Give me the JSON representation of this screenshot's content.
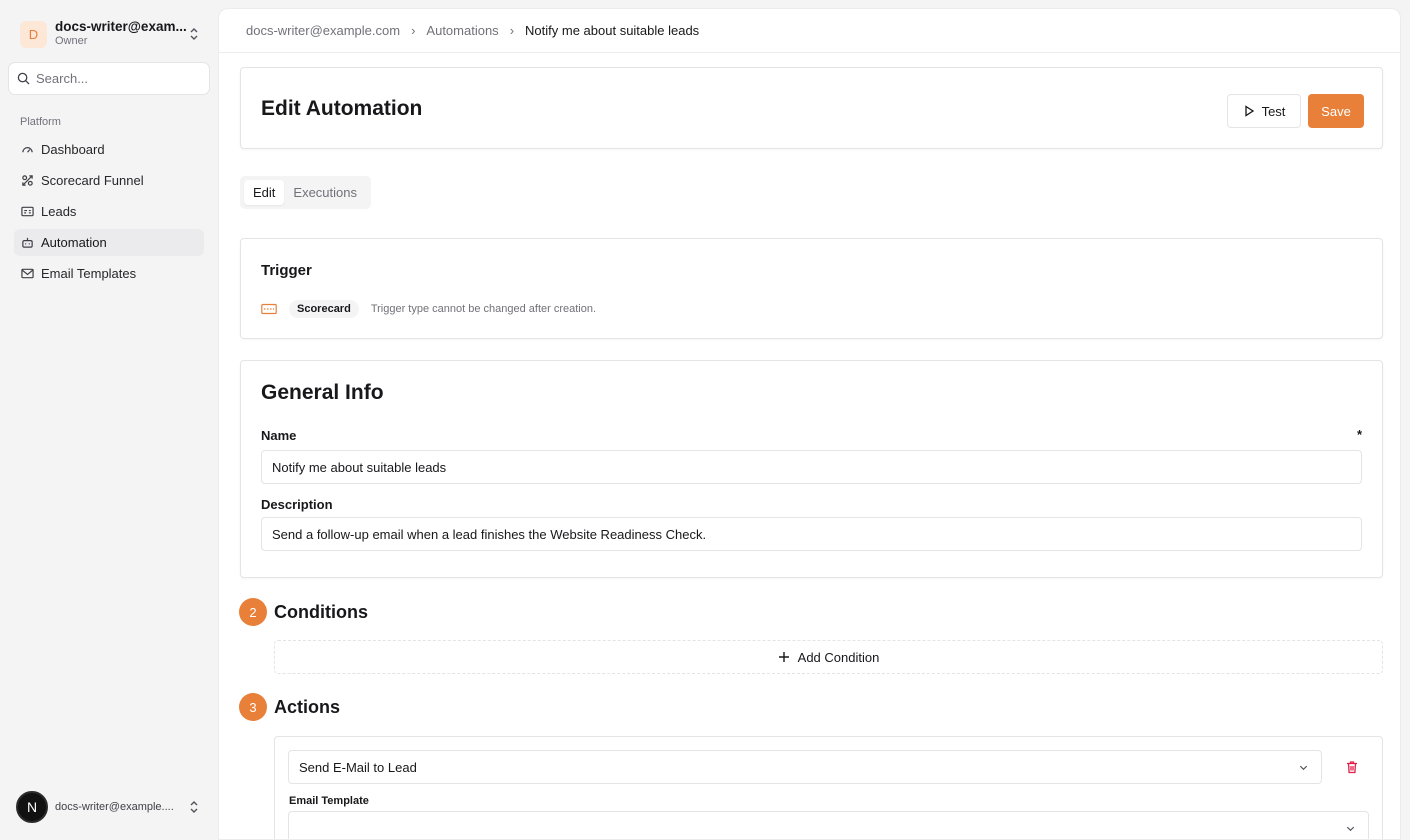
{
  "account": {
    "initial": "D",
    "name": "docs-writer@exam...",
    "role": "Owner"
  },
  "search": {
    "placeholder": "Search..."
  },
  "sidebar": {
    "section_label": "Platform",
    "items": [
      {
        "label": "Dashboard",
        "icon": "gauge-icon"
      },
      {
        "label": "Scorecard Funnel",
        "icon": "funnel-icon"
      },
      {
        "label": "Leads",
        "icon": "id-card-icon"
      },
      {
        "label": "Automation",
        "icon": "bot-icon",
        "active": true
      },
      {
        "label": "Email Templates",
        "icon": "mail-icon"
      }
    ]
  },
  "user": {
    "initial": "N",
    "email": "docs-writer@example...."
  },
  "breadcrumb": [
    "docs-writer@example.com",
    "Automations",
    "Notify me about suitable leads"
  ],
  "header": {
    "title": "Edit Automation",
    "test_label": "Test",
    "save_label": "Save"
  },
  "tabs": [
    "Edit",
    "Executions"
  ],
  "trigger": {
    "title": "Trigger",
    "badge": "Scorecard",
    "hint": "Trigger type cannot be changed after creation."
  },
  "general": {
    "title": "General Info",
    "name_label": "Name",
    "required_mark": "*",
    "name_value": "Notify me about suitable leads",
    "description_label": "Description",
    "description_value": "Send a follow-up email when a lead finishes the Website Readiness Check."
  },
  "conditions": {
    "step": "2",
    "title": "Conditions",
    "add_label": "Add Condition"
  },
  "actions": {
    "step": "3",
    "title": "Actions",
    "action_select": "Send E-Mail to Lead",
    "email_template_label": "Email Template",
    "email_template_value": ""
  },
  "colors": {
    "accent": "#e8803a",
    "danger": "#e11d48"
  }
}
